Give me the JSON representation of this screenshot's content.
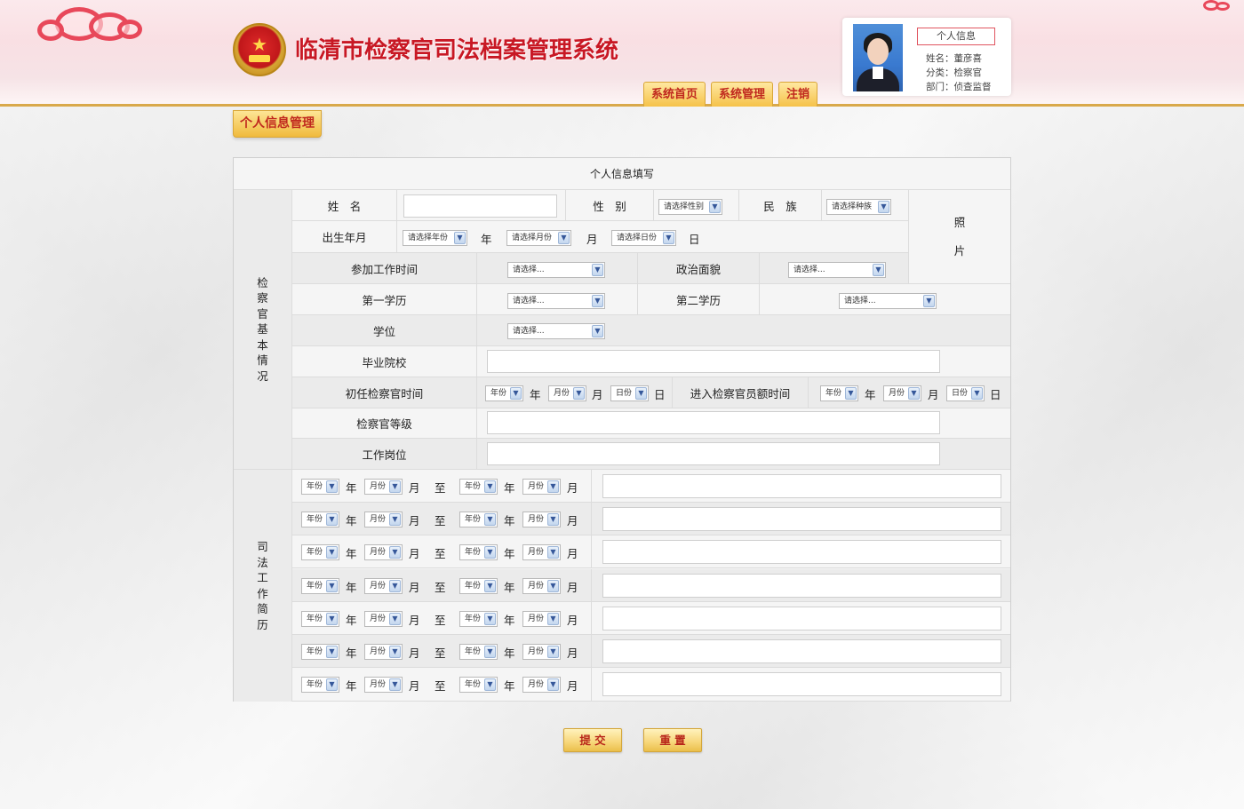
{
  "header": {
    "title": "临清市检察官司法档案管理系统",
    "nav": [
      "系统首页",
      "系统管理",
      "注销"
    ]
  },
  "profile": {
    "tag": "个人信息",
    "name": "姓名：董彦喜",
    "category": "分类：检察官",
    "department": "部门：侦查监督"
  },
  "section_tab": "个人信息管理",
  "form": {
    "title": "个人信息填写",
    "basic_group": "检察官基本情况",
    "career_group": "司法工作简历",
    "photo": [
      "照",
      "片"
    ],
    "labels": {
      "name": "姓　名",
      "gender": "性　别",
      "ethnicity": "民　族",
      "birth": "出生年月",
      "work_start": "参加工作时间",
      "politics": "政治面貌",
      "edu1": "第一学历",
      "edu2": "第二学历",
      "degree": "学位",
      "school": "毕业院校",
      "first_prosecutor": "初任检察官时间",
      "quota": "进入检察官员额时间",
      "grade": "检察官等级",
      "post": "工作岗位"
    },
    "placeholders": {
      "gender": "请选择性别",
      "ethnicity": "请选择种族",
      "year": "请选择年份",
      "month": "请选择月份",
      "day": "请选择日份",
      "choose": "请选择..."
    },
    "short": {
      "year": "年份",
      "month": "月份",
      "day": "日份"
    },
    "units": {
      "year": "年",
      "month": "月",
      "day": "日",
      "to": "至"
    },
    "career_rows": 7
  },
  "buttons": {
    "submit": "提 交",
    "reset": "重 置"
  }
}
